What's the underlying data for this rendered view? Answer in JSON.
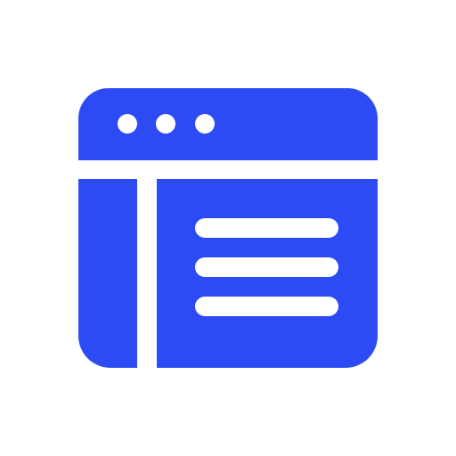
{
  "icon": {
    "name": "browser-window-layout-icon",
    "color": "#2D4BF5",
    "background": "#FFFFFF"
  }
}
